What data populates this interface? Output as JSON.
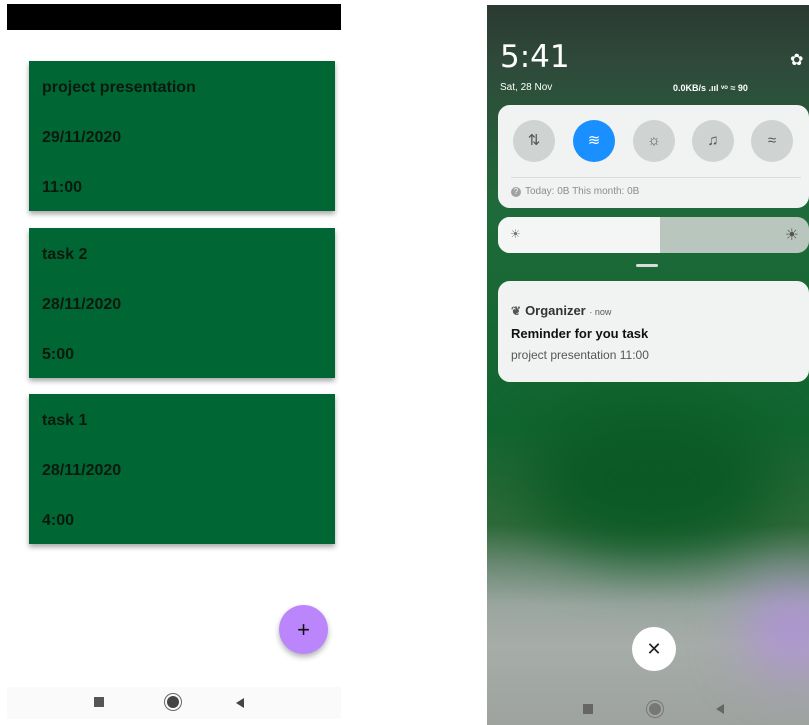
{
  "left": {
    "tasks": [
      {
        "title": "project presentation",
        "date": "29/11/2020",
        "time": "11:00"
      },
      {
        "title": "task 2",
        "date": "28/11/2020",
        "time": "5:00"
      },
      {
        "title": "task 1",
        "date": "28/11/2020",
        "time": "4:00"
      }
    ],
    "fab_label": "+",
    "card_color": "#006633",
    "fab_color": "#bb86fc"
  },
  "right": {
    "clock": "5:41",
    "date": "Sat, 28 Nov",
    "network_info": "0.0KB/s .ııl ᵛᵒ ≈ 90",
    "quick_settings": {
      "toggles": [
        {
          "icon": "mobile-data-icon",
          "glyph": "⇅",
          "active": false
        },
        {
          "icon": "wifi-icon",
          "glyph": "≋",
          "active": true
        },
        {
          "icon": "flashlight-icon",
          "glyph": "☼",
          "active": false
        },
        {
          "icon": "bell-icon",
          "glyph": "♫",
          "active": false
        },
        {
          "icon": "hotspot-icon",
          "glyph": "≈",
          "active": false
        }
      ],
      "data_usage": "Today: 0B    This month: 0B"
    },
    "brightness_level": 0.52,
    "notification": {
      "app": "Organizer",
      "time": "· now",
      "title": "Reminder for you task",
      "body": "project presentation 11:00"
    },
    "close_label": "✕",
    "accent_color": "#1a8fff"
  }
}
